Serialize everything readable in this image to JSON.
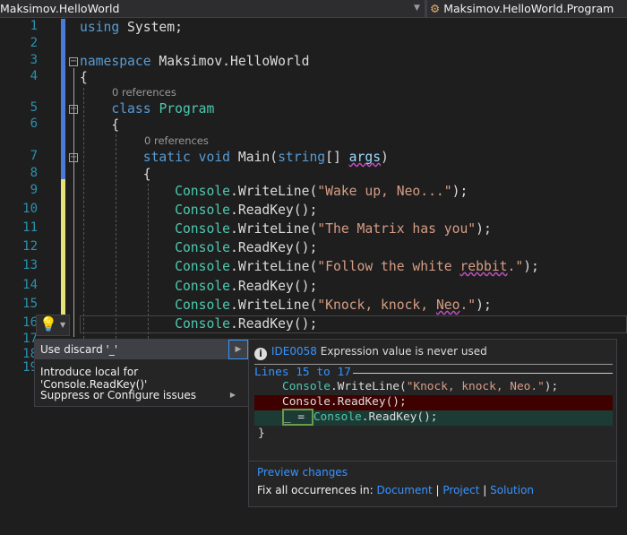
{
  "nav": {
    "project": "Maksimov.HelloWorld",
    "class": "Maksimov.HelloWorld.Program",
    "class_icon": "class-icon"
  },
  "line_numbers": [
    "1",
    "2",
    "3",
    "4",
    "5",
    "6",
    "7",
    "8",
    "9",
    "10",
    "11",
    "12",
    "13",
    "14",
    "15",
    "16",
    "17",
    "18",
    "19"
  ],
  "code_lens": {
    "class_refs": "0 references",
    "main_refs": "0 references"
  },
  "code": [
    [
      [
        "using",
        "kw"
      ],
      [
        " System;",
        "tx"
      ]
    ],
    [],
    [
      [
        "namespace",
        "kw"
      ],
      [
        " Maksimov.HelloWorld",
        "tx"
      ]
    ],
    [
      [
        "{",
        "tx"
      ]
    ],
    [
      [
        "    class",
        "kw"
      ],
      [
        " ",
        "tx"
      ],
      [
        "Program",
        "ty"
      ]
    ],
    [
      [
        "    {",
        "tx"
      ]
    ],
    [
      [
        "        static void",
        "kw"
      ],
      [
        " Main(",
        "tx"
      ],
      [
        "string",
        "kw"
      ],
      [
        "[] ",
        "tx"
      ],
      [
        "args",
        "pm sq"
      ],
      [
        ")",
        "tx"
      ]
    ],
    [
      [
        "        {",
        "tx"
      ]
    ],
    [
      [
        "            Console",
        "ty"
      ],
      [
        ".WriteLine(",
        "tx"
      ],
      [
        "\"Wake up, Neo...\"",
        "st"
      ],
      [
        ");",
        "tx"
      ]
    ],
    [
      [
        "            Console",
        "ty"
      ],
      [
        ".ReadKey();",
        "tx"
      ]
    ],
    [
      [
        "            Console",
        "ty"
      ],
      [
        ".WriteLine(",
        "tx"
      ],
      [
        "\"The Matrix has you\"",
        "st"
      ],
      [
        ");",
        "tx"
      ]
    ],
    [
      [
        "            Console",
        "ty"
      ],
      [
        ".ReadKey();",
        "tx"
      ]
    ],
    [
      [
        "            Console",
        "ty"
      ],
      [
        ".WriteLine(",
        "tx"
      ],
      [
        "\"Follow the white ",
        "st"
      ],
      [
        "rebbit",
        "st sq"
      ],
      [
        ".\"",
        "st"
      ],
      [
        ");",
        "tx"
      ]
    ],
    [
      [
        "            Console",
        "ty"
      ],
      [
        ".ReadKey();",
        "tx"
      ]
    ],
    [
      [
        "            Console",
        "ty"
      ],
      [
        ".WriteLine(",
        "tx"
      ],
      [
        "\"Knock, knock, ",
        "st"
      ],
      [
        "Neo",
        "st sq"
      ],
      [
        ".\"",
        "st"
      ],
      [
        ");",
        "tx"
      ]
    ],
    [
      [
        "            Console",
        "ty"
      ],
      [
        ".ReadKey();",
        "tx"
      ]
    ]
  ],
  "lightbulb": {
    "icon": "lightbulb-icon"
  },
  "menu": {
    "items": [
      {
        "label": "Use discard '_'",
        "selected": true
      },
      {
        "label": "Introduce local for 'Console.ReadKey()'"
      },
      {
        "label": "Suppress or Configure issues"
      }
    ]
  },
  "preview": {
    "code": "IDE0058",
    "message": "Expression value is never used",
    "range": "Lines 15 to 17",
    "lines": [
      "Console.WriteLine(\"Knock, knock, Neo.\");",
      "Console.ReadKey();",
      "_ = ",
      "Console.ReadKey();",
      "}"
    ],
    "preview_changes": "Preview changes",
    "fix_all": "Fix all occurrences in:",
    "scopes": [
      "Document",
      "Project",
      "Solution"
    ],
    "sep": "|",
    "colors": {
      "removed": "#3f0000",
      "added": "#1d3b35"
    }
  }
}
